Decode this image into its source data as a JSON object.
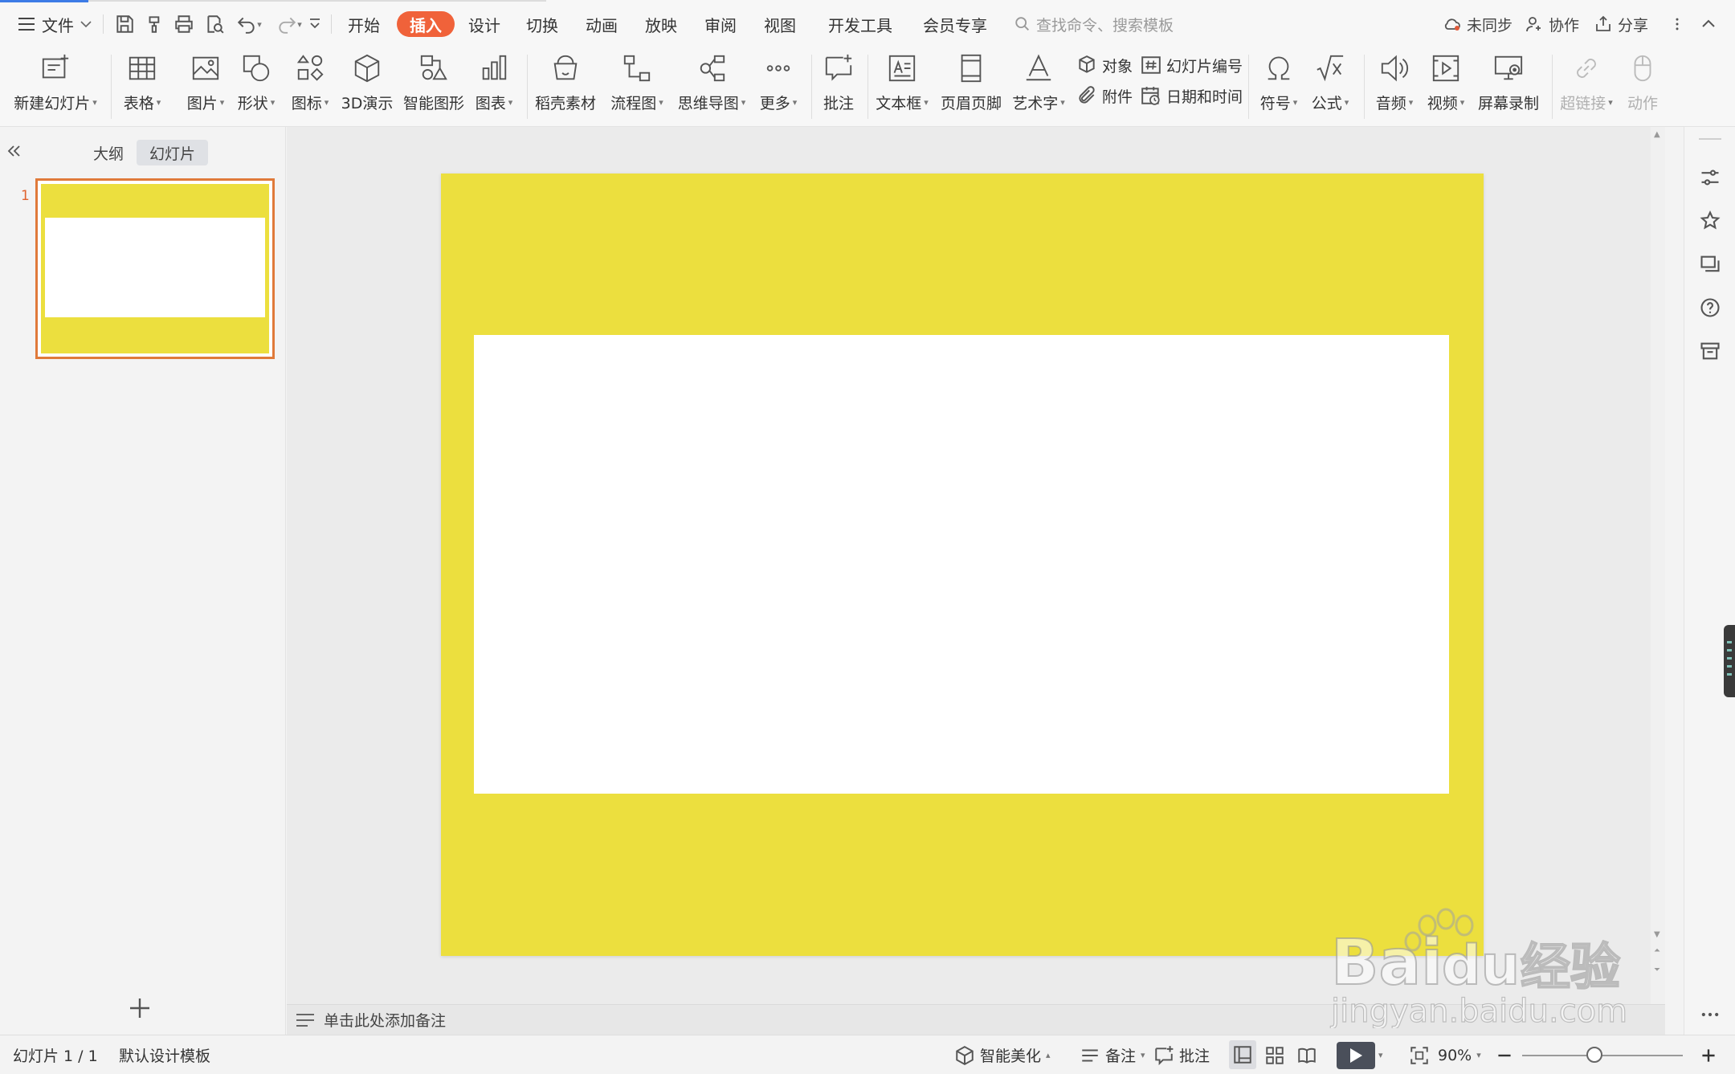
{
  "menu": {
    "file_label": "文件",
    "tabs": [
      "开始",
      "插入",
      "设计",
      "切换",
      "动画",
      "放映",
      "审阅",
      "视图",
      "开发工具",
      "会员专享"
    ],
    "active_tab": "插入",
    "search_placeholder": "查找命令、搜索模板",
    "sync_label": "未同步",
    "collab_label": "协作",
    "share_label": "分享"
  },
  "ribbon": {
    "new_slide": "新建幻灯片",
    "table": "表格",
    "picture": "图片",
    "shape": "形状",
    "icon": "图标",
    "demo3d": "3D演示",
    "smartart": "智能图形",
    "chart": "图表",
    "daoke": "稻壳素材",
    "flowchart": "流程图",
    "mindmap": "思维导图",
    "more": "更多",
    "comment": "批注",
    "textbox": "文本框",
    "header_footer": "页眉页脚",
    "wordart": "艺术字",
    "object": "对象",
    "slide_number": "幻灯片编号",
    "attachment": "附件",
    "datetime": "日期和时间",
    "symbol": "符号",
    "formula": "公式",
    "audio": "音频",
    "video": "视频",
    "screen_record": "屏幕录制",
    "hyperlink": "超链接",
    "action": "动作"
  },
  "panel": {
    "outline_tab": "大纲",
    "slides_tab": "幻灯片",
    "slide_number": "1"
  },
  "slide": {
    "background_color": "#ecdf3e",
    "box_color": "#ffffff"
  },
  "notes": {
    "placeholder": "单击此处添加备注"
  },
  "status": {
    "slide_counter": "幻灯片 1 / 1",
    "template": "默认设计模板",
    "beautify": "智能美化",
    "notes": "备注",
    "comments": "批注",
    "zoom": "90%"
  },
  "watermark": {
    "brand": "Bai du 经验",
    "url": "jingyan.baidu.com"
  },
  "colors": {
    "accent": "#f0623a",
    "selection_border": "#e07a3a"
  }
}
